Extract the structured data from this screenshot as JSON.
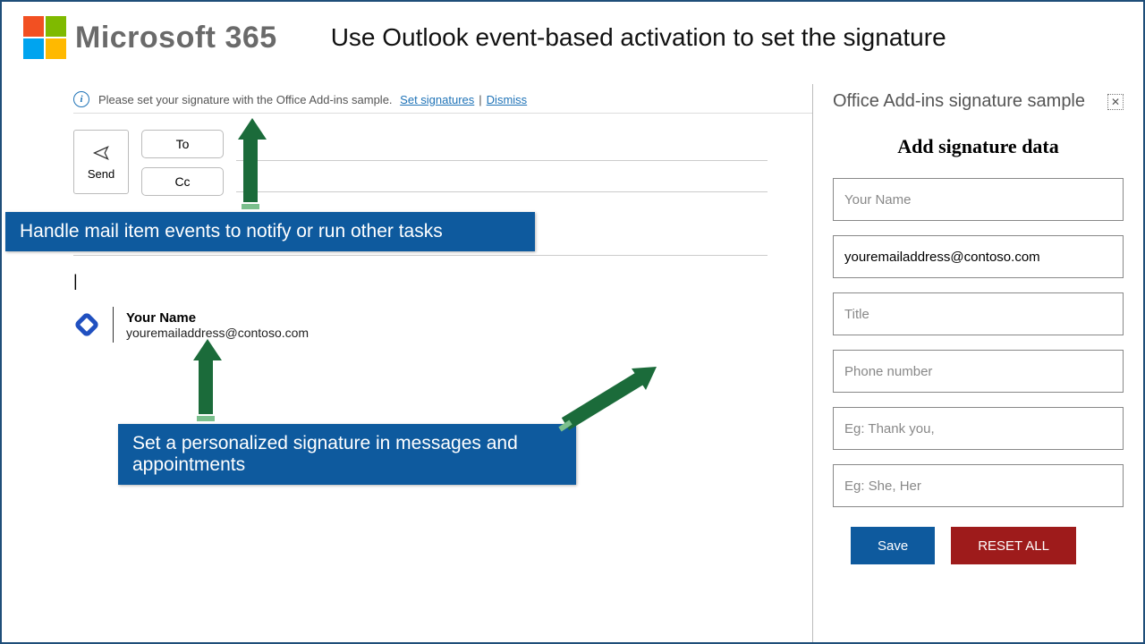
{
  "header": {
    "logo_text": "Microsoft 365",
    "title": "Use Outlook event-based activation to set the signature"
  },
  "info_bar": {
    "text": "Please set your signature with the Office Add-ins sample.",
    "link_set": "Set signatures",
    "separator": "|",
    "link_dismiss": "Dismiss"
  },
  "compose": {
    "send_label": "Send",
    "to_label": "To",
    "cc_label": "Cc"
  },
  "signature": {
    "name": "Your Name",
    "email": "youremailaddress@contoso.com"
  },
  "callouts": {
    "c1": "Handle mail item events to notify or run other tasks",
    "c2": "Set a personalized signature in messages and appointments"
  },
  "taskpane": {
    "title": "Office Add-ins signature sample",
    "heading": "Add signature data",
    "fields": {
      "name_placeholder": "Your Name",
      "email_value": "youremailaddress@contoso.com",
      "title_placeholder": "Title",
      "phone_placeholder": "Phone number",
      "greeting_placeholder": "Eg: Thank you,",
      "pronoun_placeholder": "Eg: She, Her"
    },
    "save_label": "Save",
    "reset_label": "RESET ALL"
  }
}
